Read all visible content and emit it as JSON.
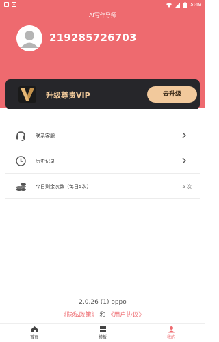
{
  "status_bar": {
    "time": "5:49",
    "left_badge": "x"
  },
  "app": {
    "title": "AI写作导师"
  },
  "profile": {
    "username": "219285726703"
  },
  "vip": {
    "label": "升级尊贵VIP",
    "logo_letter": "V",
    "button_label": "去升级"
  },
  "menu": {
    "items": [
      {
        "label": "联系客服",
        "icon": "headset-icon"
      },
      {
        "label": "历史记录",
        "icon": "clock-icon"
      },
      {
        "label": "今日剩余次数（每日5次）",
        "icon": "coins-icon",
        "value": "5 次"
      }
    ]
  },
  "footer": {
    "version": "2.0.26 (1) oppo",
    "privacy_link": "《隐私政策》",
    "and_text": "和",
    "agreement_link": "《用户协议》"
  },
  "tabs": [
    {
      "label": "首页",
      "icon": "home-icon",
      "active": false
    },
    {
      "label": "模板",
      "icon": "grid-icon",
      "active": false
    },
    {
      "label": "我的",
      "icon": "person-icon",
      "active": true
    }
  ],
  "colors": {
    "brand": "#ee6a6f",
    "vip_bg": "#26262a",
    "vip_gold": "#f2c99c"
  }
}
